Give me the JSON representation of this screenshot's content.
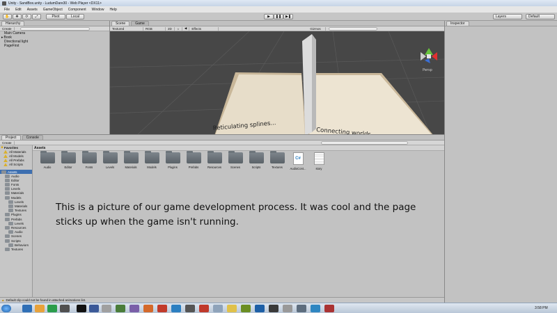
{
  "window": {
    "title": "Unity - SandBox.unity - LudumDare30 - Web Player <DX11>"
  },
  "menu": [
    "File",
    "Edit",
    "Assets",
    "GameObject",
    "Component",
    "Window",
    "Help"
  ],
  "toolbar": {
    "pivot": "Pivot",
    "local": "Local",
    "layers": "Layers",
    "layout": "Default"
  },
  "hierarchy": {
    "tab": "Hierarchy",
    "create": "Create",
    "search_placeholder": "All",
    "items": [
      "Main Camera",
      "Book",
      "Directional light",
      "PageFirst"
    ]
  },
  "scene": {
    "tab_scene": "Scene",
    "tab_game": "Game",
    "shading": "Textured",
    "render": "RGB",
    "mode_2d": "2D",
    "effects": "Effects",
    "gizmos": "Gizmos",
    "search_placeholder": "All",
    "persp": "Persp",
    "left_page_text": "Reticulating splines...",
    "right_page_text": "Connecting worlds..."
  },
  "inspector": {
    "tab": "Inspector"
  },
  "project": {
    "tab_project": "Project",
    "tab_console": "Console",
    "create": "Create",
    "path": "Assets",
    "favorites": {
      "label": "Favorites",
      "items": [
        "All Materials",
        "All Models",
        "All Prefabs",
        "All Scripts"
      ]
    },
    "tree": [
      {
        "label": "Assets",
        "level": 0
      },
      {
        "label": "Audio",
        "level": 1
      },
      {
        "label": "Editor",
        "level": 1
      },
      {
        "label": "Fonts",
        "level": 1
      },
      {
        "label": "Levels",
        "level": 1
      },
      {
        "label": "Materials",
        "level": 1
      },
      {
        "label": "Models",
        "level": 1
      },
      {
        "label": "Levels",
        "level": 2
      },
      {
        "label": "Materials",
        "level": 2
      },
      {
        "label": "Textures",
        "level": 2
      },
      {
        "label": "Plugins",
        "level": 1
      },
      {
        "label": "Prefabs",
        "level": 1
      },
      {
        "label": "Levels",
        "level": 2
      },
      {
        "label": "Resources",
        "level": 1
      },
      {
        "label": "Audio",
        "level": 2
      },
      {
        "label": "Scenes",
        "level": 1
      },
      {
        "label": "Scripts",
        "level": 1
      },
      {
        "label": "Behaviors",
        "level": 2
      },
      {
        "label": "Textures",
        "level": 1
      }
    ],
    "assets": [
      {
        "label": "Audio",
        "kind": "folder"
      },
      {
        "label": "Editor",
        "kind": "folder"
      },
      {
        "label": "Fonts",
        "kind": "folder"
      },
      {
        "label": "Levels",
        "kind": "folder"
      },
      {
        "label": "Materials",
        "kind": "folder"
      },
      {
        "label": "Models",
        "kind": "folder"
      },
      {
        "label": "Plugins",
        "kind": "folder"
      },
      {
        "label": "Prefabs",
        "kind": "folder"
      },
      {
        "label": "Resources",
        "kind": "folder"
      },
      {
        "label": "Scenes",
        "kind": "folder"
      },
      {
        "label": "Scripts",
        "kind": "folder"
      },
      {
        "label": "Textures",
        "kind": "folder"
      },
      {
        "label": "AudioCont...",
        "kind": "script"
      },
      {
        "label": "story",
        "kind": "text"
      }
    ]
  },
  "caption": "This is a picture of our game development process.  It was cool and the page sticks up when the game isn't running.",
  "status": "Default clip could not be found in attached animations list.",
  "taskbar": {
    "clock": "3:58 PM"
  },
  "colors": {
    "scene_bg": "#474747",
    "folder": "#6a7278",
    "page": "#e7ddc9",
    "accent_yellow": "#f0c445"
  }
}
